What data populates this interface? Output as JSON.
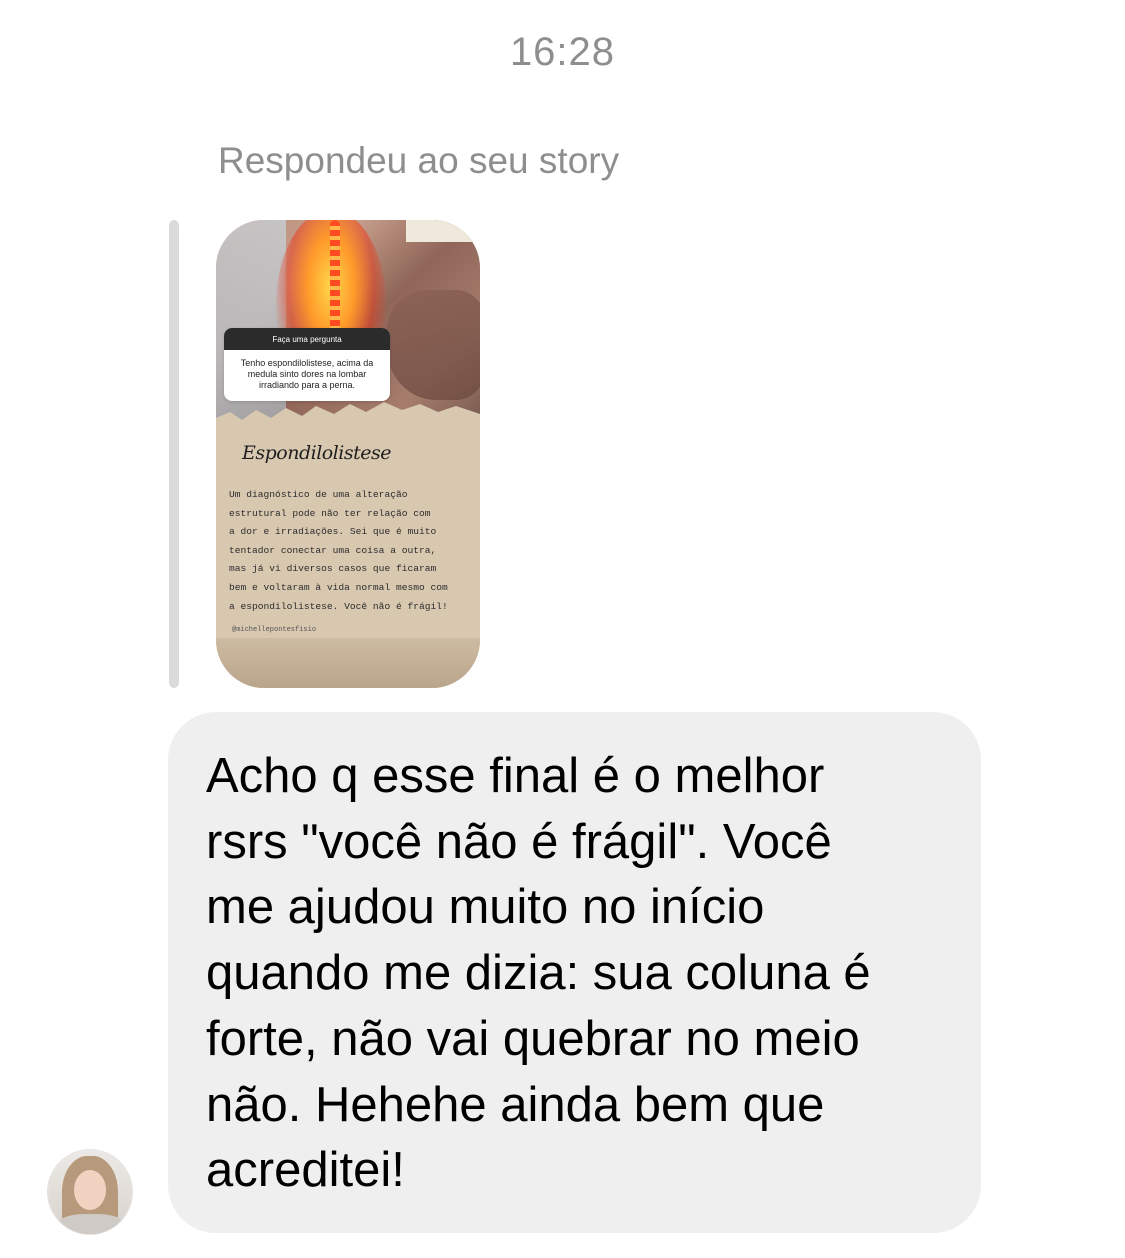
{
  "timestamp": "16:28",
  "reply": {
    "caption": "Respondeu ao seu story"
  },
  "story": {
    "question_header": "Faça uma pergunta",
    "question_text": "Tenho espondilolistese, acima da medula sinto dores na lombar irradiando para a perna.",
    "title": "Espondilolistese",
    "body_lines": [
      "Um diagnóstico de uma alteração",
      "estrutural pode não ter relação com",
      "a dor e irradiações. Sei que é muito",
      "tentador conectar uma coisa a outra,",
      "mas já vi diversos casos que ficaram",
      "bem e voltaram à vida normal mesmo com",
      "a espondilolistese. Você não é frágil!"
    ],
    "handle": "@michellepontesfisio"
  },
  "message": {
    "text": "Acho q esse final é o melhor\nrsrs \"você não é frágil\". Você\nme ajudou muito no início\nquando me dizia: sua coluna é\nforte, não vai quebrar no meio\nnão. Hehehe ainda bem que\nacreditei!"
  },
  "sender": {
    "avatar_icon": "profile-photo"
  }
}
